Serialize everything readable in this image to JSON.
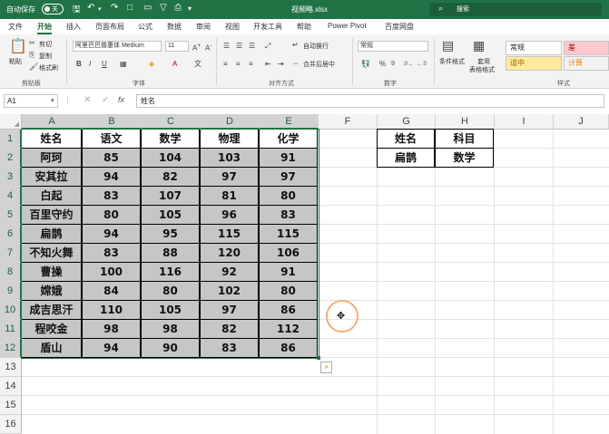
{
  "titlebar": {
    "autosave_label": "自动保存",
    "autosave_state": "关",
    "filename": "视频略.xlsx",
    "search_label": "搜索",
    "accent": "#217346"
  },
  "menu": {
    "tabs": [
      "文件",
      "开始",
      "插入",
      "页面布局",
      "公式",
      "数据",
      "审阅",
      "视图",
      "开发工具",
      "帮助",
      "Power Pivot",
      "百度网盘"
    ]
  },
  "ribbon": {
    "clipboard": {
      "paste": "粘贴",
      "cut": "剪切",
      "copy": "复制",
      "format_painter": "格式刷",
      "group_label": "剪贴板"
    },
    "font": {
      "font_name": "阿里巴巴普惠体 Medium",
      "font_size": "11",
      "group_label": "字体"
    },
    "alignment": {
      "wrap": "自动换行",
      "merge": "合并后居中",
      "group_label": "对齐方式"
    },
    "number": {
      "format": "常规",
      "group_label": "数字"
    },
    "styles": {
      "conditional": "条件格式",
      "table_fmt_1": "套用",
      "table_fmt_2": "表格格式",
      "normal": "常规",
      "bad": "差",
      "neutral": "适中",
      "calc": "计算",
      "group_label": "样式"
    }
  },
  "formula_bar": {
    "cell_ref": "A1",
    "formula": "姓名"
  },
  "grid": {
    "columns": [
      "A",
      "B",
      "C",
      "D",
      "E",
      "F",
      "G",
      "H",
      "I",
      "J"
    ],
    "rows": [
      "1",
      "2",
      "3",
      "4",
      "5",
      "6",
      "7",
      "8",
      "9",
      "10",
      "11",
      "12",
      "13",
      "14",
      "15",
      "16"
    ],
    "table_header": [
      "姓名",
      "语文",
      "数学",
      "物理",
      "化学"
    ],
    "table_rows": [
      [
        "阿珂",
        "85",
        "104",
        "103",
        "91"
      ],
      [
        "安其拉",
        "94",
        "82",
        "97",
        "97"
      ],
      [
        "白起",
        "83",
        "107",
        "81",
        "80"
      ],
      [
        "百里守约",
        "80",
        "105",
        "96",
        "83"
      ],
      [
        "扁鹊",
        "94",
        "95",
        "115",
        "115"
      ],
      [
        "不知火舞",
        "83",
        "88",
        "120",
        "106"
      ],
      [
        "曹操",
        "100",
        "116",
        "92",
        "91"
      ],
      [
        "嫦娥",
        "84",
        "80",
        "102",
        "80"
      ],
      [
        "成吉思汗",
        "110",
        "105",
        "97",
        "86"
      ],
      [
        "程咬金",
        "98",
        "98",
        "82",
        "112"
      ],
      [
        "盾山",
        "94",
        "90",
        "83",
        "86"
      ]
    ],
    "lookup_header": [
      "姓名",
      "科目"
    ],
    "lookup_row": [
      "扁鹊",
      "数学"
    ]
  }
}
